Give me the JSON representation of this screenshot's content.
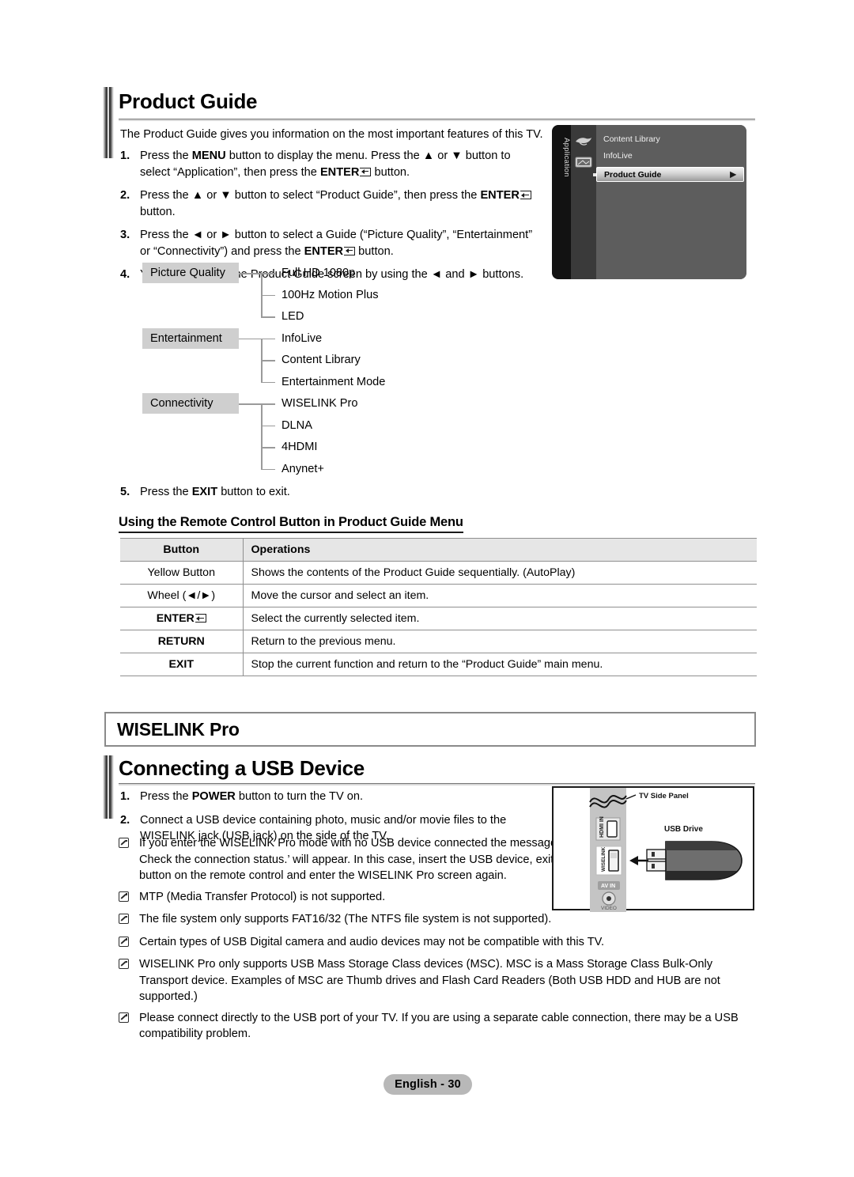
{
  "sections": {
    "product_guide": {
      "title": "Product Guide",
      "intro": "The Product Guide gives you information on the most important features of this TV.",
      "steps": [
        {
          "num": "1.",
          "html": "Press the <b>MENU</b> button to display the menu. Press the ▲ or ▼ button to select “Application”, then press the <b>ENTER</b><span class=\"entglyph\"></span> button."
        },
        {
          "num": "2.",
          "html": "Press the ▲ or ▼ button to select “Product Guide”, then press the <b>ENTER</b><span class=\"entglyph\"></span> button."
        },
        {
          "num": "3.",
          "html": "Press the ◄ or ► button to select a Guide (“Picture Quality”, “Entertainment” or “Connectivity”) and press the <b>ENTER</b><span class=\"entglyph\"></span> button."
        },
        {
          "num": "4.",
          "html": "You can navigate the Product Guide screen by using the ◄ and ► buttons."
        }
      ],
      "final_step": {
        "num": "5.",
        "html": "Press the <b>EXIT</b> button to exit."
      }
    },
    "wiselink": {
      "title": "WISELINK Pro"
    },
    "usb": {
      "title": "Connecting a USB Device",
      "steps": [
        {
          "num": "1.",
          "html": "Press the <b>POWER</b> button to turn the TV on."
        },
        {
          "num": "2.",
          "html": "Connect a USB device containing photo, music and/or movie files to the WISELINK jack (USB jack) on the side of the TV."
        }
      ],
      "notes": [
        "If you enter the WISELINK Pro mode with no USB device connected the message ‘No external storage device found. Check the connection status.’ will appear. In this case, insert the USB device, exit the screen by pressing the <b>W.LINK</b> button on the remote control and enter the WISELINK Pro screen again.",
        "MTP (Media Transfer Protocol) is not supported.",
        "The file system only supports FAT16/32 (The NTFS file system is not supported).",
        "Certain types of USB Digital camera and audio devices may not be compatible with this TV.",
        "WISELINK Pro only supports USB Mass Storage Class devices (MSC). MSC is a Mass Storage Class Bulk-Only Transport device. Examples of MSC are Thumb drives and Flash Card Readers (Both USB HDD and HUB are not supported.)",
        "Please connect directly to the USB port of your TV. If you are using a separate cable connection, there may be a USB compatibility problem."
      ]
    }
  },
  "tv_osd": {
    "sidebar_label": "Application",
    "items": [
      {
        "label": "Content Library",
        "selected": false
      },
      {
        "label": "InfoLive",
        "selected": false
      },
      {
        "label": "Product Guide",
        "selected": true,
        "arrow": "▶"
      }
    ],
    "icons": [
      "bird-icon",
      "tv-icon"
    ]
  },
  "tree": {
    "groups": [
      {
        "label": "Picture Quality",
        "leaves": [
          "Full HD 1080p",
          "100Hz Motion Plus",
          "LED"
        ]
      },
      {
        "label": "Entertainment",
        "leaves": [
          "InfoLive",
          "Content Library",
          "Entertainment Mode"
        ]
      },
      {
        "label": "Connectivity",
        "leaves": [
          "WISELINK Pro",
          "DLNA",
          "4HDMI",
          "Anynet+"
        ]
      }
    ]
  },
  "remote_table": {
    "heading": "Using the Remote Control Button in Product Guide Menu",
    "columns": [
      "Button",
      "Operations"
    ],
    "rows": [
      {
        "button": "Yellow Button",
        "bold": false,
        "enter_glyph": false,
        "operation": "Shows the contents of the Product Guide sequentially. (AutoPlay)"
      },
      {
        "button": "Wheel (◄/►)",
        "bold": false,
        "enter_glyph": false,
        "operation": "Move the cursor and select an item."
      },
      {
        "button": "ENTER",
        "bold": true,
        "enter_glyph": true,
        "operation": "Select the currently selected item."
      },
      {
        "button": "RETURN",
        "bold": true,
        "enter_glyph": false,
        "operation": "Return to the previous menu."
      },
      {
        "button": "EXIT",
        "bold": true,
        "enter_glyph": false,
        "operation": "Stop the current function and return to the “Product Guide” main menu."
      }
    ]
  },
  "usb_diagram": {
    "panel_label": "TV Side Panel",
    "drive_label": "USB Drive",
    "ports": [
      "HDMI IN",
      "WISELINK",
      "AV IN",
      "VIDEO"
    ]
  },
  "footer": {
    "label": "English - 30"
  },
  "colors": {
    "tree_box_bg": "#cfcfcf",
    "table_header_bg": "#e6e6e6",
    "footer_bg": "#b8b8b8",
    "osd_bg": "#5d5d5d",
    "osd_sidebar": "#121212"
  }
}
